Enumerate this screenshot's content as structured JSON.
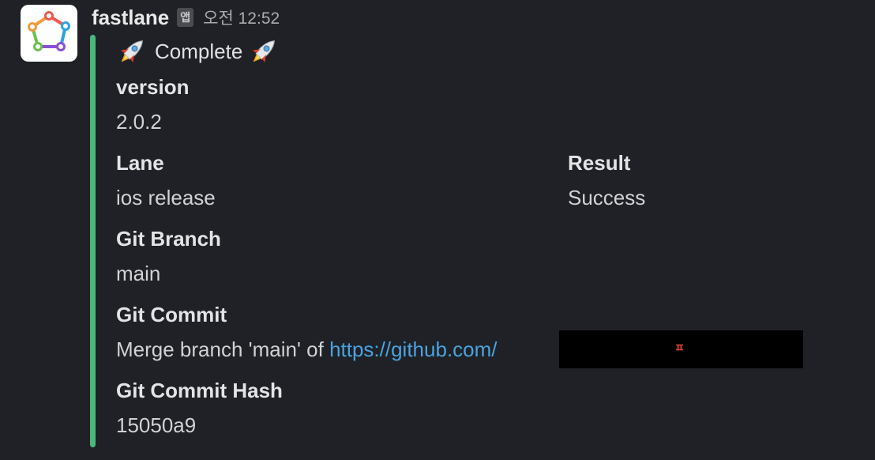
{
  "message": {
    "sender": "fastlane",
    "app_badge": "앱",
    "timestamp": "오전 12:52",
    "avatar_icon": "fastlane-logo-icon"
  },
  "attachment": {
    "accent_color": "#4bb87a",
    "title_icon": "rocket-emoji",
    "title": "Complete",
    "fields": {
      "version": {
        "name": "version",
        "value": "2.0.2"
      },
      "lane": {
        "name": "Lane",
        "value": "ios release"
      },
      "result": {
        "name": "Result",
        "value": "Success"
      },
      "git_branch": {
        "name": "Git Branch",
        "value": "main"
      },
      "git_commit": {
        "name": "Git Commit",
        "value_prefix": "Merge branch 'main' of ",
        "link_text": "https://github.com/",
        "redaction_mark": "ㅍ"
      },
      "git_commit_hash": {
        "name": "Git Commit Hash",
        "value": "15050a9"
      }
    }
  }
}
